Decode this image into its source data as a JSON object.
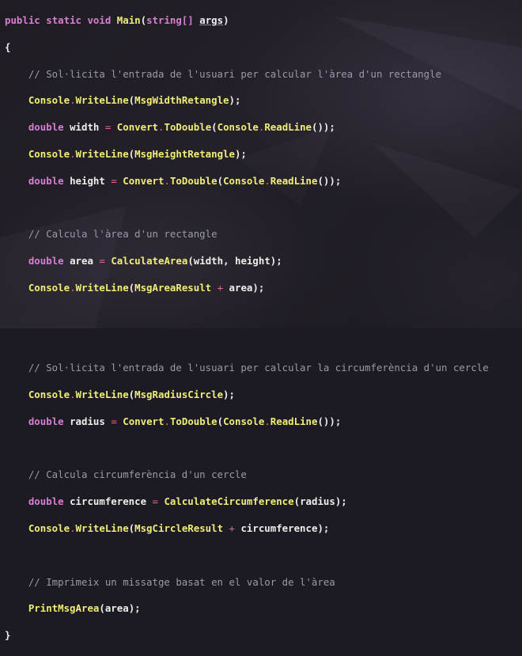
{
  "code": {
    "signature": {
      "kw_public": "public",
      "kw_static": "static",
      "kw_void": "void",
      "name": "Main",
      "open": "(",
      "type": "string[]",
      "param": "args",
      "close": ")"
    },
    "open_brace": "{",
    "close_brace": "}",
    "comment_1": "// Sol·licita l'entrada de l'usuari per calcular l'àrea d'un rectangle",
    "comment_2": "// Calcula l'àrea d'un rectangle",
    "comment_3": "// Sol·licita l'entrada de l'usuari per calcular la circumferència d'un cercle",
    "comment_4": "// Calcula circumferència d'un cercle",
    "comment_5": "// Imprimeix un missatge basat en el valor de l'àrea",
    "tokens": {
      "Console": "Console",
      "WriteLine": "WriteLine",
      "ReadLine": "ReadLine",
      "Convert": "Convert",
      "ToDouble": "ToDouble",
      "double": "double",
      "dot": ".",
      "eq": "=",
      "plus": "+",
      "MsgWidthRetangle": "MsgWidthRetangle",
      "MsgHeightRetangle": "MsgHeightRetangle",
      "MsgAreaResult": "MsgAreaResult",
      "MsgRadiusCircle": "MsgRadiusCircle",
      "MsgCircleResult": "MsgCircleResult",
      "width": "width",
      "height": "height",
      "area": "area",
      "radius": "radius",
      "circumference": "circumference",
      "CalculateArea": "CalculateArea",
      "CalculateCircumference": "CalculateCircumference",
      "PrintMsgArea": "PrintMsgArea"
    }
  },
  "colors": {
    "keyword": "#d77fd0",
    "function": "#f0ee77",
    "operator": "#e86a88",
    "identifier": "#eeeeea",
    "comment": "#9a9aa8",
    "background": "#1c1a22"
  }
}
